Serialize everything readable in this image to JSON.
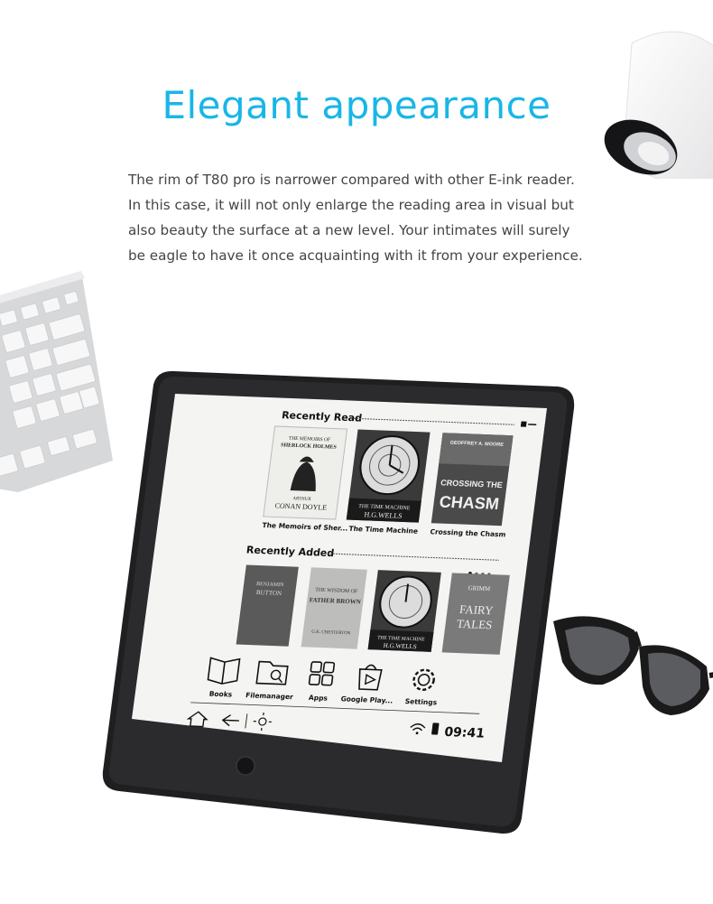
{
  "header": {
    "title": "Elegant appearance",
    "title_color": "#19b6e6"
  },
  "description": {
    "lines": [
      "The rim of T80 pro is narrower compared with other E-ink reader.",
      "In this case, it will not only enlarge the reading area in visual but",
      "also beauty the surface at a new level. Your intimates will surely",
      "be eagle to have it once acquainting with it from your experience."
    ]
  },
  "device": {
    "body_color": "#1f1f21",
    "screen_color": "#f4f4f2",
    "recently_read": {
      "label": "Recently Read",
      "books": [
        {
          "title": "The Memoirs of Sher...",
          "cover_line1": "THE MEMOIRS OF",
          "cover_line2": "SHERLOCK HOLMES",
          "cover_author1": "ARTHUR",
          "cover_author2": "CONAN DOYLE",
          "icon": "silhouette-cover"
        },
        {
          "title": "The Time Machine",
          "cover_line1": "THE TIME MACHINE",
          "cover_author1": "H.G.WELLS",
          "icon": "clock-cover"
        },
        {
          "title": "Crossing the Chasm",
          "cover_line1": "CROSSING THE",
          "cover_line2": "CHASM",
          "cover_author1": "GEOFFREY A. MOORE",
          "icon": "chasm-cover"
        }
      ]
    },
    "recently_added": {
      "label": "Recently Added",
      "books": [
        {
          "cover_line1": "BENJAMIN",
          "cover_line2": "BUTTON",
          "icon": "benjamin-button-cover"
        },
        {
          "cover_line1": "THE WISDOM OF",
          "cover_line2": "FATHER BROWN",
          "cover_author1": "G.K. CHESTERTON",
          "icon": "father-brown-cover"
        },
        {
          "cover_line1": "THE TIME MACHINE",
          "cover_author1": "H.G.WELLS",
          "icon": "clock-cover"
        },
        {
          "cover_line1": "GRIMM",
          "cover_line2": "FAIRY",
          "cover_line3": "TALES",
          "icon": "grimm-cover"
        }
      ]
    },
    "apps": [
      {
        "label": "Books",
        "icon": "book-icon"
      },
      {
        "label": "Filemanager",
        "icon": "folder-search-icon"
      },
      {
        "label": "Apps",
        "icon": "apps-grid-icon"
      },
      {
        "label": "Google Play...",
        "icon": "play-store-icon"
      },
      {
        "label": "Settings",
        "icon": "gear-icon"
      }
    ],
    "status_bar": {
      "time": "09:41",
      "icons": [
        "home-icon",
        "back-icon",
        "brightness-icon",
        "wifi-icon",
        "battery-icon"
      ]
    }
  }
}
